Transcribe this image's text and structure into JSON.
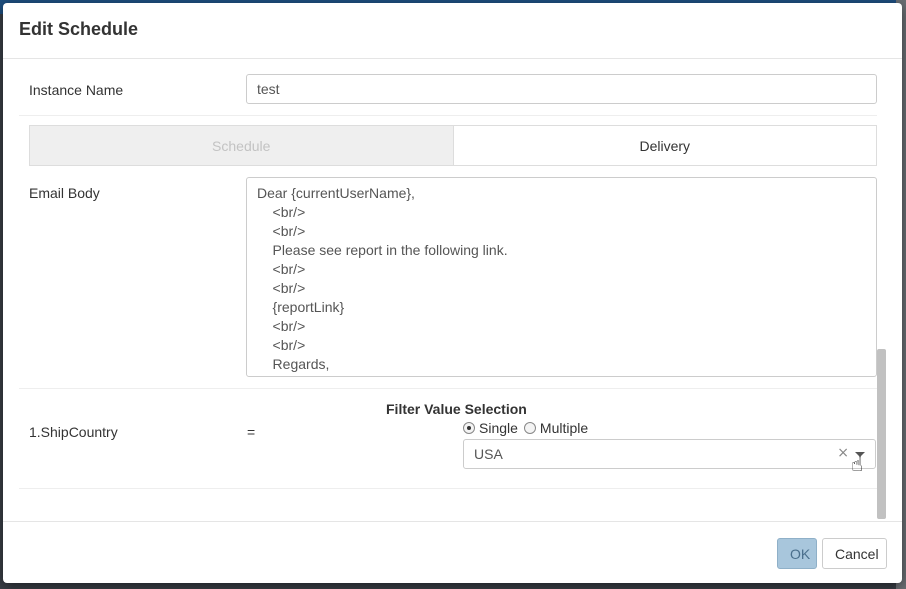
{
  "dialog": {
    "title": "Edit Schedule"
  },
  "instance": {
    "label": "Instance Name",
    "value": "test"
  },
  "tabs": [
    {
      "label": "Schedule",
      "active": false
    },
    {
      "label": "Delivery",
      "active": true
    }
  ],
  "email": {
    "label": "Email Body",
    "lines": [
      "Dear {currentUserName},",
      "    <br/>",
      "    <br/>",
      "    Please see report in the following link.",
      "    <br/>",
      "    <br/>",
      "    {reportLink}",
      "    <br/>",
      "    <br/>",
      "    Regards,"
    ]
  },
  "filter": {
    "field_label": "1.ShipCountry",
    "operator": "=",
    "section_title": "Filter Value Selection",
    "mode_single": "Single",
    "mode_multiple": "Multiple",
    "selected_mode": "Single",
    "selected_value": "USA",
    "clear_glyph": "×"
  },
  "footer": {
    "ok_label": "OK",
    "cancel_label": "Cancel"
  },
  "icons": {
    "clear": "clear-icon",
    "dropdown": "chevron-down-icon",
    "cursor": "hand-pointer-icon"
  }
}
